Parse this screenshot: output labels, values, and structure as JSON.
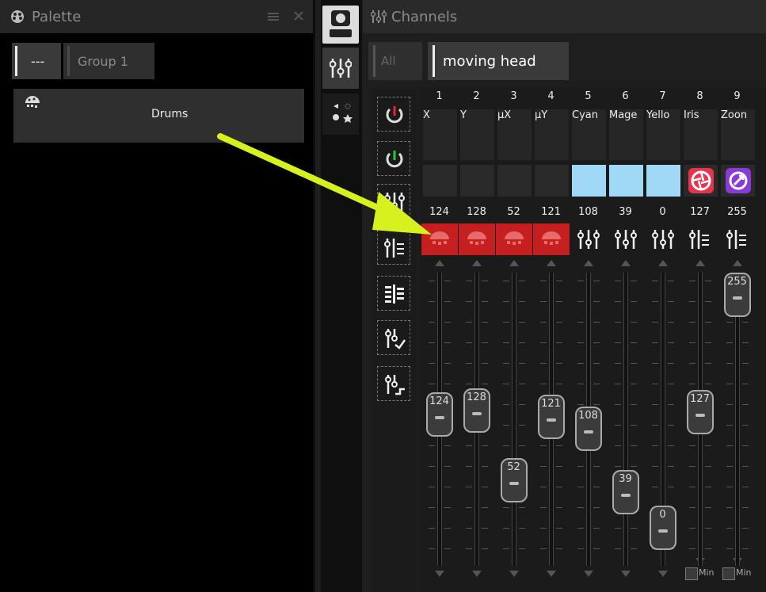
{
  "palette": {
    "title": "Palette",
    "tabs": {
      "dash": "---",
      "group": "Group 1"
    },
    "item": "Drums"
  },
  "channels": {
    "title": "Channels",
    "filter_all": "All",
    "filter_active": "moving head",
    "columns": [
      {
        "num": "1",
        "name": "X",
        "value": "124"
      },
      {
        "num": "2",
        "name": "Y",
        "value": "128"
      },
      {
        "num": "3",
        "name": "µX",
        "value": "52"
      },
      {
        "num": "4",
        "name": "µY",
        "value": "121"
      },
      {
        "num": "5",
        "name": "Cyan",
        "value": "108"
      },
      {
        "num": "6",
        "name": "Mage",
        "value": "39"
      },
      {
        "num": "7",
        "name": "Yello",
        "value": "0"
      },
      {
        "num": "8",
        "name": "Iris",
        "value": "127"
      },
      {
        "num": "9",
        "name": "Zoon",
        "value": "255"
      }
    ],
    "min_label_1": "Min",
    "min_label_2": "Min"
  },
  "colors": {
    "accent_arrow": "#d7f11f",
    "selected_red": "#c61f1f",
    "light_blue": "#9fd9f5"
  }
}
